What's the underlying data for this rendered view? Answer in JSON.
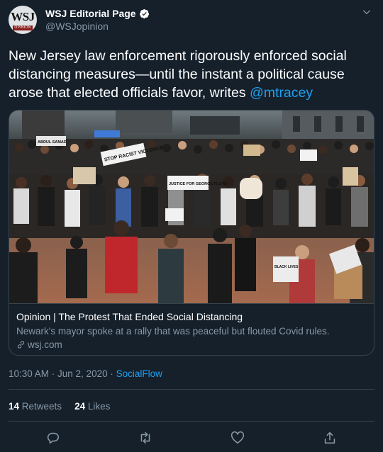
{
  "tweet": {
    "author_name": "WSJ Editorial Page",
    "handle": "@WSJopinion",
    "avatar_text": "WSJ",
    "avatar_band": "OPINION",
    "text_before_mention": "New Jersey law enforcement rigorously enforced social distancing measures—until the instant a political cause arose that elected officials favor, writes ",
    "mention": "@mtracey",
    "timestamp": "10:30 AM · Jun 2, 2020 · ",
    "source": "SocialFlow"
  },
  "card": {
    "title": "Opinion | The Protest That Ended Social Distancing",
    "description": "Newark's mayor spoke at a rally that was peaceful but flouted Covid rules.",
    "domain": "wsj.com",
    "sign_texts": [
      "STOP RACIST VIOLENCE",
      "JUSTICE FOR GEORGE FLOYD",
      "ABDUL SAMAD",
      "BLACK LIVES"
    ]
  },
  "stats": {
    "retweets_count": "14",
    "retweets_label": " Retweets",
    "likes_count": "24",
    "likes_label": " Likes"
  },
  "icons": {
    "verified": "verified-badge-icon",
    "chevron": "chevron-down-icon",
    "link": "link-icon",
    "reply": "reply-icon",
    "retweet": "retweet-icon",
    "like": "heart-icon",
    "share": "share-icon"
  },
  "colors": {
    "background": "#15202b",
    "accent": "#1da1f2",
    "secondary_text": "#8899a6",
    "border": "#38444d"
  }
}
